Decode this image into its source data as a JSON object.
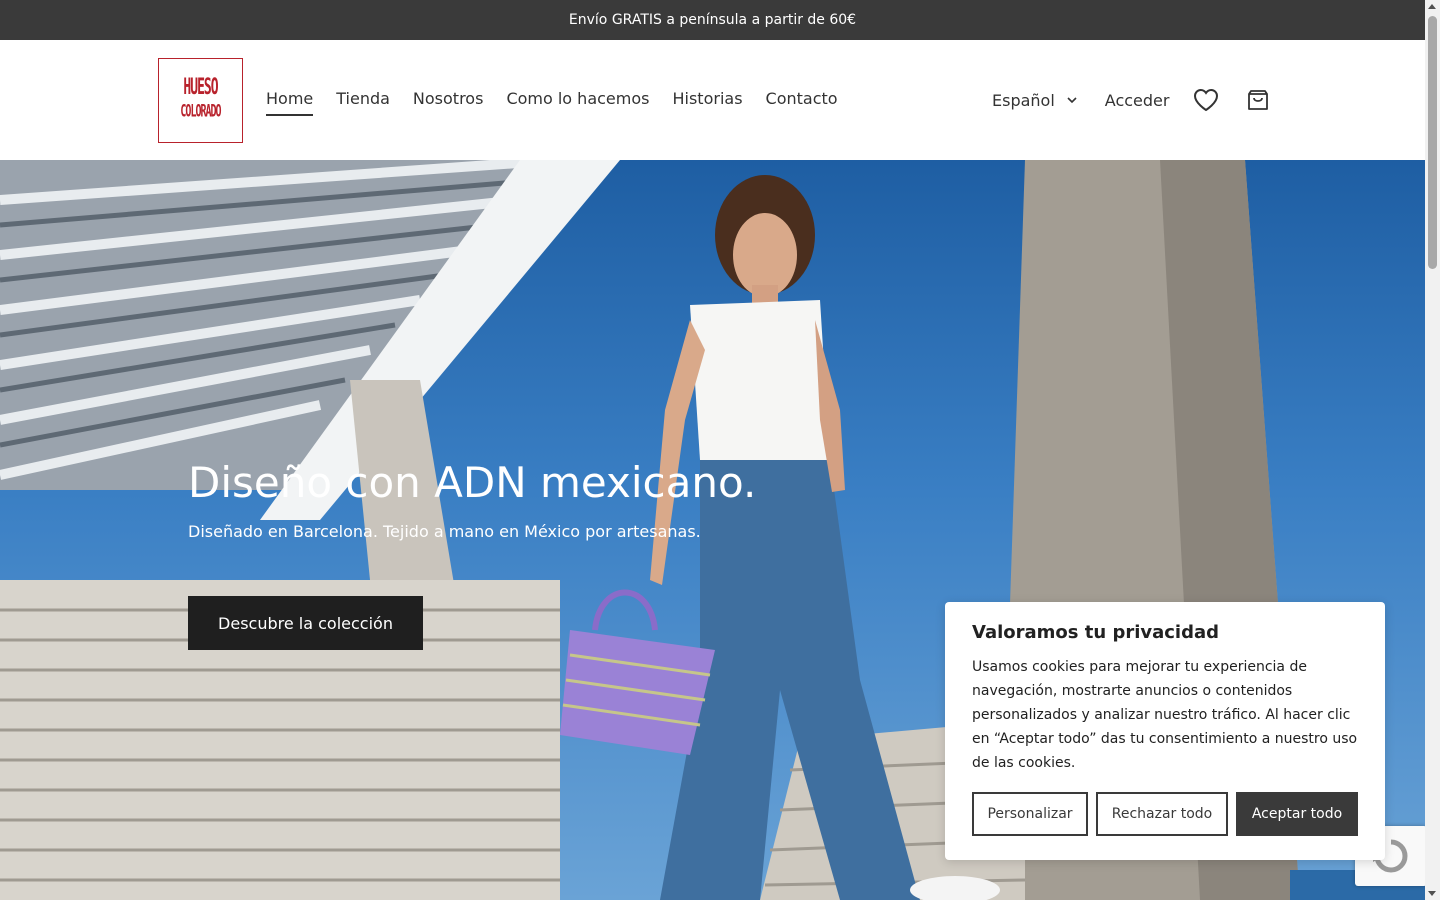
{
  "announcement": {
    "text": "Envío GRATIS a península a partir de 60€"
  },
  "logo": {
    "line1": "HUESO",
    "line2": "COLORADO",
    "color": "#b8222c"
  },
  "nav": {
    "items": [
      {
        "label": "Home",
        "active": true
      },
      {
        "label": "Tienda"
      },
      {
        "label": "Nosotros"
      },
      {
        "label": "Como lo hacemos"
      },
      {
        "label": "Historias"
      },
      {
        "label": "Contacto"
      }
    ]
  },
  "tools": {
    "language": "Español",
    "login": "Acceder",
    "wishlist_icon": "heart-icon",
    "cart_icon": "cart-icon"
  },
  "hero": {
    "title": "Diseño con ADN mexicano.",
    "subtitle": "Diseñado en Barcelona. Tejido a mano en México por artesanas.",
    "cta": "Descubre la colección"
  },
  "cookie_banner": {
    "title": "Valoramos tu privacidad",
    "body": "Usamos cookies para mejorar tu experiencia de navegación, mostrarte anuncios o contenidos personalizados y analizar nuestro tráfico. Al hacer clic en “Aceptar todo” das tu consentimiento a nuestro uso de las cookies.",
    "customize": "Personalizar",
    "reject": "Rechazar todo",
    "accept": "Aceptar todo"
  }
}
